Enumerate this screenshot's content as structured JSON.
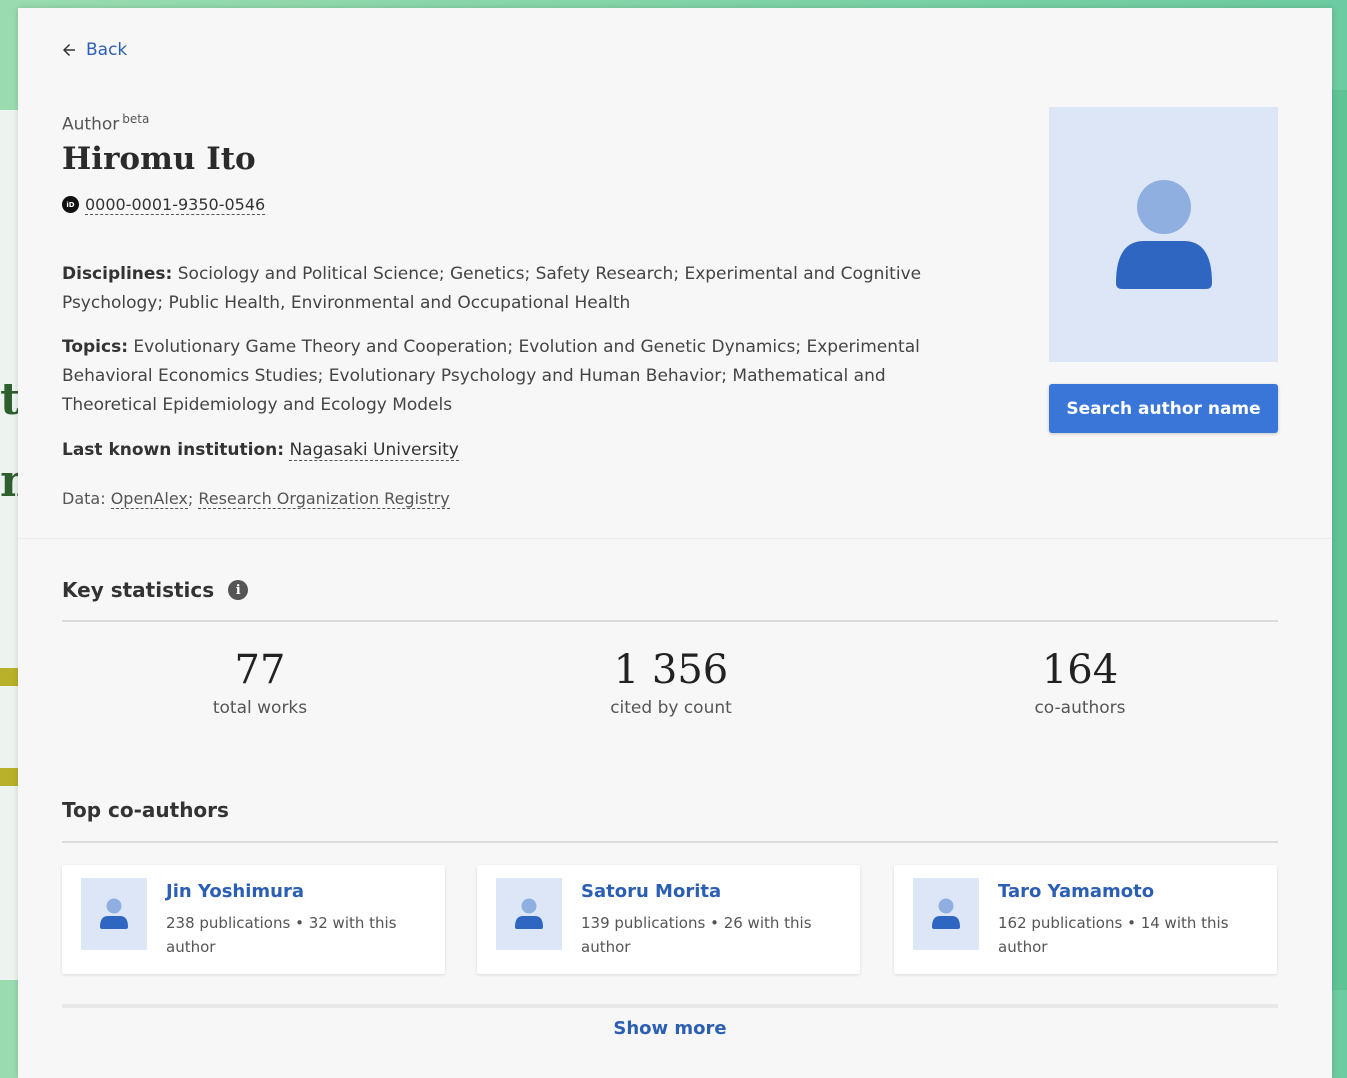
{
  "nav": {
    "back_label": "Back",
    "back_icon": "arrow-left-icon"
  },
  "author": {
    "kind_label": "Author",
    "kind_badge": "beta",
    "name": "Hiromu Ito",
    "orcid_icon": "orcid-icon",
    "orcid": "0000-0001-9350-0546"
  },
  "meta": {
    "disciplines_label": "Disciplines:",
    "disciplines": "Sociology and Political Science; Genetics; Safety Research; Experimental and Cognitive Psychology; Public Health, Environmental and Occupational Health",
    "topics_label": "Topics:",
    "topics": "Evolutionary Game Theory and Cooperation; Evolution and Genetic Dynamics; Experimental Behavioral Economics Studies; Evolutionary Psychology and Human Behavior; Mathematical and Theoretical Epidemiology and Ecology Models",
    "institution_label": "Last known institution:",
    "institution": "Nagasaki University",
    "data_label": "Data:",
    "data_sources": [
      "OpenAlex",
      "Research Organization Registry"
    ],
    "data_separator": ";"
  },
  "actions": {
    "search_author_label": "Search author name"
  },
  "key_statistics": {
    "title": "Key statistics",
    "stats": [
      {
        "value": "77",
        "label": "total works"
      },
      {
        "value": "1 356",
        "label": "cited by count"
      },
      {
        "value": "164",
        "label": "co-authors"
      }
    ]
  },
  "coauthors": {
    "title": "Top co-authors",
    "items": [
      {
        "name": "Jin Yoshimura",
        "publications": "238 publications",
        "with_author": "32 with this author"
      },
      {
        "name": "Satoru Morita",
        "publications": "139 publications",
        "with_author": "26 with this author"
      },
      {
        "name": "Taro Yamamoto",
        "publications": "162 publications",
        "with_author": "14 with this author"
      }
    ],
    "separator": "•",
    "show_more_label": "Show more"
  },
  "colors": {
    "accent": "#3a76d8",
    "link": "#2c5fb3",
    "avatar_bg": "#dce6f6",
    "avatar_head": "#8fafe0",
    "avatar_body": "#2f66c2"
  }
}
